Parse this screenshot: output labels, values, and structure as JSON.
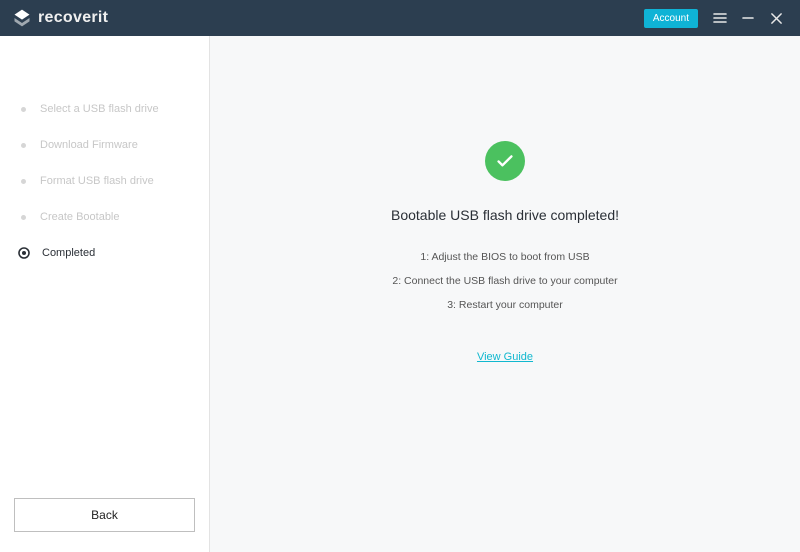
{
  "app": {
    "name": "recoverit",
    "accountButton": "Account"
  },
  "sidebar": {
    "steps": [
      {
        "label": "Select a USB flash drive",
        "active": false
      },
      {
        "label": "Download Firmware",
        "active": false
      },
      {
        "label": "Format USB flash drive",
        "active": false
      },
      {
        "label": "Create Bootable",
        "active": false
      },
      {
        "label": "Completed",
        "active": true
      }
    ],
    "backButton": "Back"
  },
  "main": {
    "title": "Bootable USB flash drive completed!",
    "instructions": [
      "1: Adjust the BIOS to boot from USB",
      "2: Connect the USB flash drive to your computer",
      "3: Restart your computer"
    ],
    "guideLink": "View Guide"
  },
  "colors": {
    "accent": "#0fb3d6",
    "success": "#4bc15f",
    "header": "#2c3e50"
  }
}
